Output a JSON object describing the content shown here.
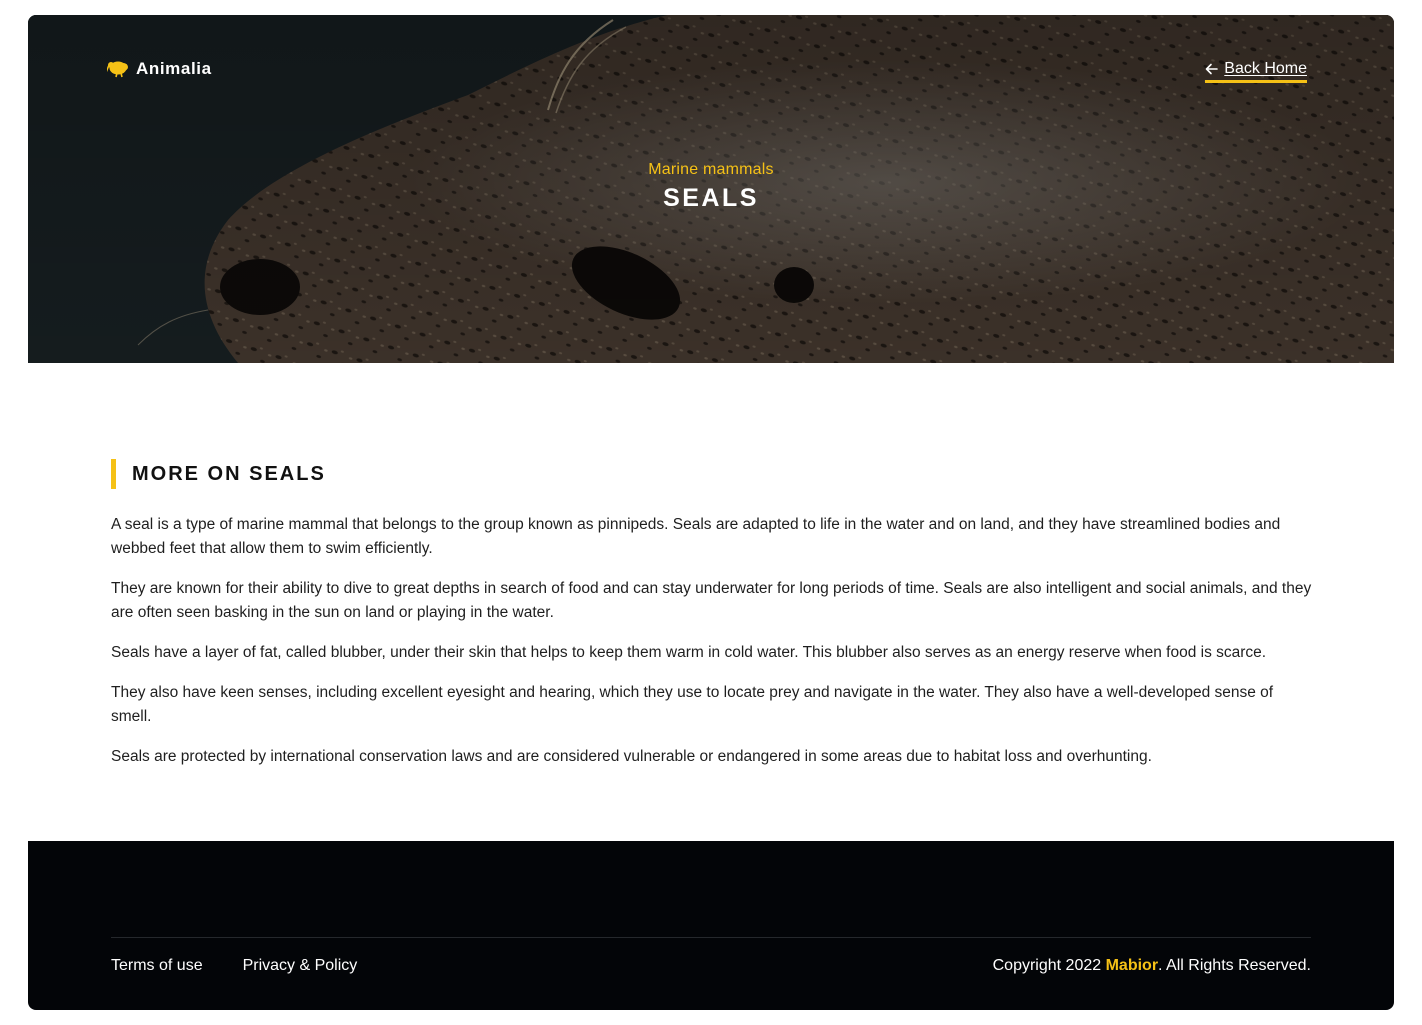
{
  "colors": {
    "accent": "#f5c116",
    "footer_bg": "#030508",
    "text": "#1f1f1f"
  },
  "header": {
    "brand_name": "Animalia",
    "brand_icon": "kiwi-bird-icon",
    "back_link": {
      "icon": "arrow-left-icon",
      "label": "Back Home"
    }
  },
  "hero": {
    "subtitle": "Marine mammals",
    "title": "SEALS",
    "image": "seal-photo"
  },
  "main": {
    "section_title": "MORE ON SEALS",
    "paragraphs": [
      "A seal is a type of marine mammal that belongs to the group known as pinnipeds. Seals are adapted to life in the water and on land, and they have streamlined bodies and webbed feet that allow them to swim efficiently.",
      "They are known for their ability to dive to great depths in search of food and can stay underwater for long periods of time. Seals are also intelligent and social animals, and they are often seen basking in the sun on land or playing in the water.",
      "Seals have a layer of fat, called blubber, under their skin that helps to keep them warm in cold water. This blubber also serves as an energy reserve when food is scarce.",
      "They also have keen senses, including excellent eyesight and hearing, which they use to locate prey and navigate in the water. They also have a well-developed sense of smell.",
      "Seals are protected by international conservation laws and are considered vulnerable or endangered in some areas due to habitat loss and overhunting."
    ]
  },
  "footer": {
    "links": [
      "Terms of use",
      "Privacy & Policy"
    ],
    "copyright_prefix": "Copyright 2022 ",
    "copyright_brand": "Mabior",
    "copyright_suffix": ". All Rights Reserved."
  }
}
